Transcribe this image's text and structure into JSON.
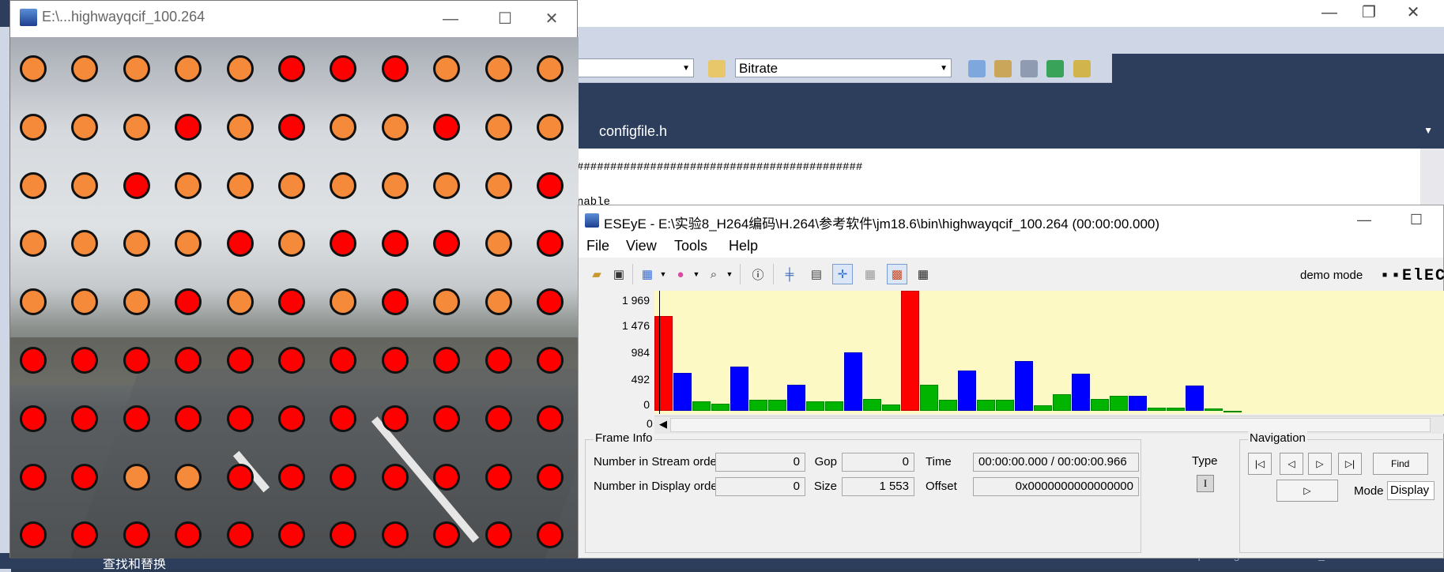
{
  "ide": {
    "bitrate_combo": "Bitrate",
    "tab_label": "configfile.h",
    "code_line1": "###########################################",
    "code_line2": "nable",
    "bottom_text": "查找和替换",
    "watermark": "https://blog.csdn.net/weixin_46735955",
    "window_controls": [
      "—",
      "❐",
      "✕"
    ]
  },
  "video": {
    "title": "E:\\...highwayqcif_100.264",
    "window_controls": [
      "—",
      "☐",
      "✕"
    ],
    "dot_grid": [
      [
        "o",
        "o",
        "o",
        "o",
        "o",
        "r",
        "r",
        "r",
        "o",
        "o",
        "o"
      ],
      [
        "o",
        "o",
        "o",
        "r",
        "o",
        "r",
        "o",
        "o",
        "r",
        "o",
        "o"
      ],
      [
        "o",
        "o",
        "r",
        "o",
        "o",
        "o",
        "o",
        "o",
        "o",
        "o",
        "r"
      ],
      [
        "o",
        "o",
        "o",
        "o",
        "r",
        "o",
        "r",
        "r",
        "r",
        "o",
        "r"
      ],
      [
        "o",
        "o",
        "o",
        "r",
        "o",
        "r",
        "o",
        "r",
        "o",
        "o",
        "r"
      ],
      [
        "r",
        "r",
        "r",
        "r",
        "r",
        "r",
        "r",
        "r",
        "r",
        "r",
        "r"
      ],
      [
        "r",
        "r",
        "r",
        "r",
        "r",
        "r",
        "r",
        "r",
        "r",
        "r",
        "r"
      ],
      [
        "r",
        "r",
        "o",
        "o",
        "r",
        "r",
        "r",
        "r",
        "r",
        "r",
        "r"
      ],
      [
        "r",
        "r",
        "r",
        "r",
        "r",
        "r",
        "r",
        "r",
        "r",
        "r",
        "r"
      ]
    ]
  },
  "eseye": {
    "title": "ESEyE - E:\\实验8_H264编码\\H.264\\参考软件\\jm18.6\\bin\\highwayqcif_100.264 (00:00:00.000)",
    "menu": [
      "File",
      "View",
      "Tools",
      "Help"
    ],
    "demo_mode": "demo mode",
    "logo": "▪▪ElEC",
    "chart_data": {
      "type": "bar",
      "y_ticks": [
        "1 969",
        "1 476",
        "984",
        "492",
        "0"
      ],
      "x_axis_zero": "0",
      "ylim": [
        0,
        1969
      ],
      "frame_types": [
        "I",
        "P",
        "B",
        "B",
        "P",
        "B",
        "B",
        "P",
        "B",
        "B",
        "P",
        "B",
        "B",
        "I",
        "B",
        "B",
        "P",
        "B",
        "B",
        "P",
        "B",
        "B",
        "P",
        "B",
        "B",
        "P",
        "B",
        "B",
        "P",
        "B",
        "B"
      ],
      "values": [
        1553,
        620,
        150,
        120,
        720,
        180,
        180,
        430,
        160,
        160,
        960,
        190,
        110,
        1969,
        430,
        180,
        660,
        180,
        180,
        810,
        90,
        270,
        610,
        200,
        250,
        240,
        50,
        50,
        410,
        40,
        0
      ],
      "colors": {
        "I": "#ff0000",
        "P": "#0000ff",
        "B": "#00b400"
      },
      "plot_bg": "#fdf9c4"
    },
    "frame_info": {
      "group_label": "Frame Info",
      "stream_order_label": "Number in Stream order",
      "stream_order_value": "0",
      "display_order_label": "Number in Display order",
      "display_order_value": "0",
      "gop_label": "Gop",
      "gop_value": "0",
      "size_label": "Size",
      "size_value": "1 553",
      "time_label": "Time",
      "time_value": "00:00:00.000 / 00:00:00.966",
      "offset_label": "Offset",
      "offset_value": "0x0000000000000000",
      "type_label": "Type",
      "type_value": "I"
    },
    "navigation": {
      "group_label": "Navigation",
      "find_label": "Find",
      "mode_label": "Mode",
      "mode_value": "Display"
    }
  }
}
